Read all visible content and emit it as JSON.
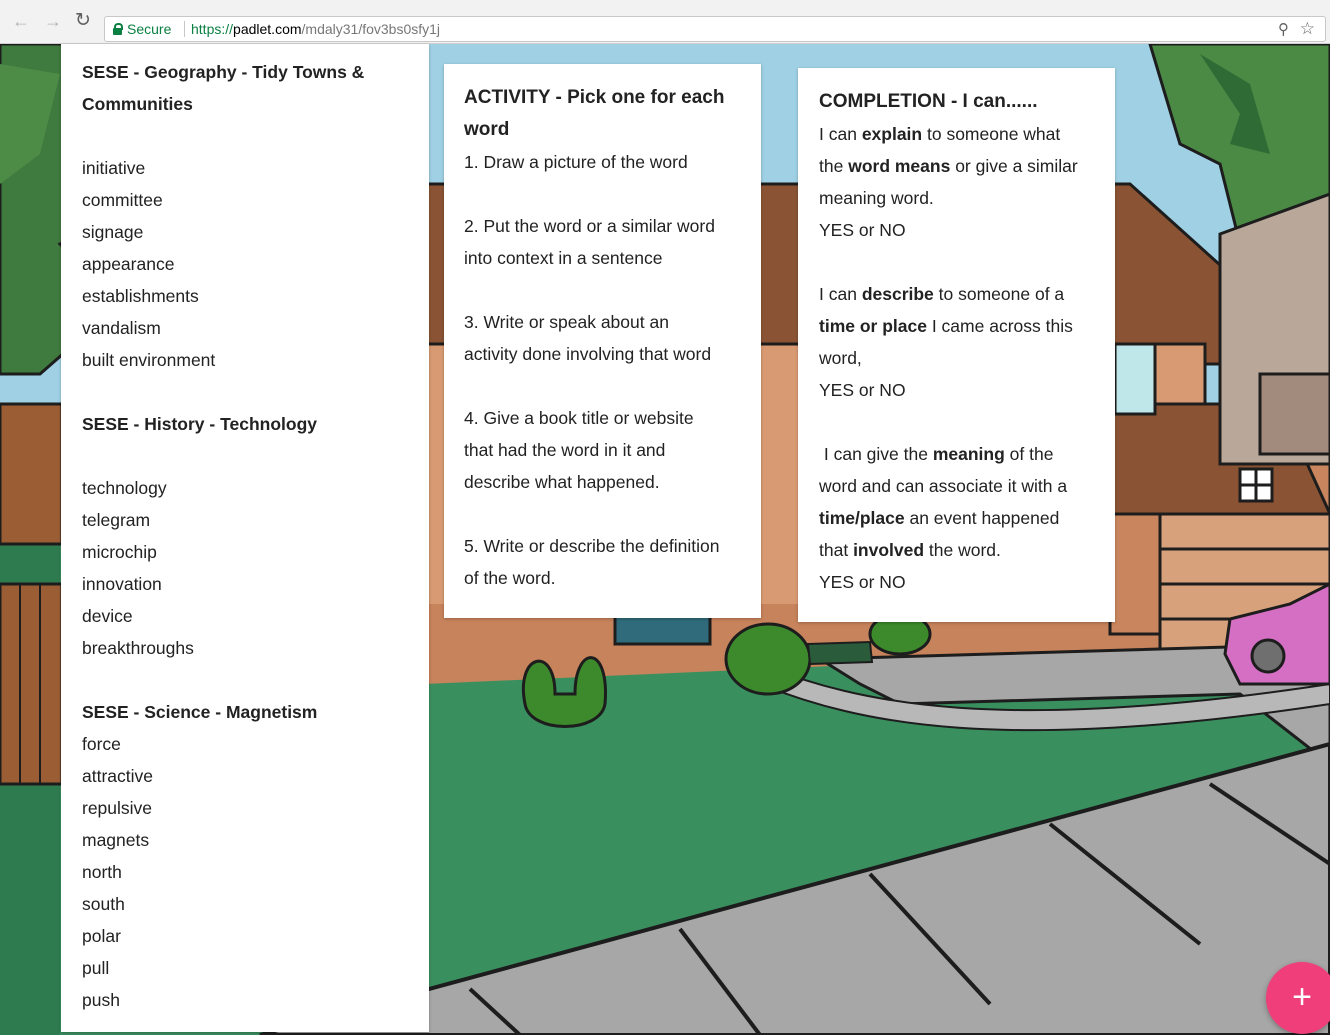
{
  "browser": {
    "secure_label": "Secure",
    "url_scheme": "https://",
    "url_host": "padlet.com",
    "url_path": "/mdaly31/fov3bs0sfy1j",
    "icons": [
      "back-arrow-icon",
      "forward-arrow-icon",
      "reload-icon",
      "lock-icon",
      "zoom-icon",
      "star-icon"
    ]
  },
  "cards": {
    "geography": {
      "title_line1": "SESE - Geography - Tidy Towns &",
      "title_line2": "Communities",
      "words": [
        "initiative",
        "committee",
        "signage",
        "appearance",
        "establishments",
        "vandalism",
        "built environment"
      ],
      "history_heading": "SESE - History - Technology",
      "history_words": [
        "technology",
        "telegram",
        "microchip",
        "innovation",
        "device",
        "breakthroughs"
      ],
      "science_heading": "SESE - Science - Magnetism",
      "science_words": [
        "force",
        "attractive",
        "repulsive",
        "magnets",
        "north",
        "south",
        "polar",
        "pull",
        "push"
      ]
    },
    "activity": {
      "title_line1": "ACTIVITY - Pick one for each",
      "title_line2": "word",
      "lines": [
        "1. Draw a picture of the word",
        "",
        "2. Put the word or a similar word",
        "into context in a sentence",
        "",
        "3. Write or speak about an",
        "activity done involving that word",
        "",
        "4. Give a book title or website",
        "that had the word in it and",
        "describe what happened.",
        "",
        "5. Write or describe the definition",
        "of the word."
      ]
    },
    "completion": {
      "title": "COMPLETION - I can......",
      "b1": {
        "l1_pre": "I can ",
        "l1_bold": "explain",
        "l1_post": " to someone what",
        "l2_pre": "the ",
        "l2_bold": "word means",
        "l2_post": " or give a similar",
        "l3": "meaning word.",
        "answer": "YES or NO"
      },
      "b2": {
        "l1_pre": "I can ",
        "l1_bold": "describe",
        "l1_post": " to someone of a",
        "l2_bold": "time or place",
        "l2_post": " I came across this",
        "l3": "word,",
        "answer": "YES or NO"
      },
      "b3": {
        "l1_pre": " I can give the ",
        "l1_bold": "meaning",
        "l1_post": " of the",
        "l2": "word and can associate it with a",
        "l3_bold": "time/place",
        "l3_post": " an event happened",
        "l4_pre": "that ",
        "l4_bold": "involved",
        "l4_post": " the word.",
        "answer": "YES or NO"
      }
    }
  },
  "fab": {
    "label": "+",
    "icon": "plus-icon"
  },
  "colors": {
    "sky": "#9fd0e4",
    "grass": "#3a8f5f",
    "sidewalk": "#a7a7a7",
    "fab": "#ef3e7a",
    "secure_green": "#0b8043"
  }
}
